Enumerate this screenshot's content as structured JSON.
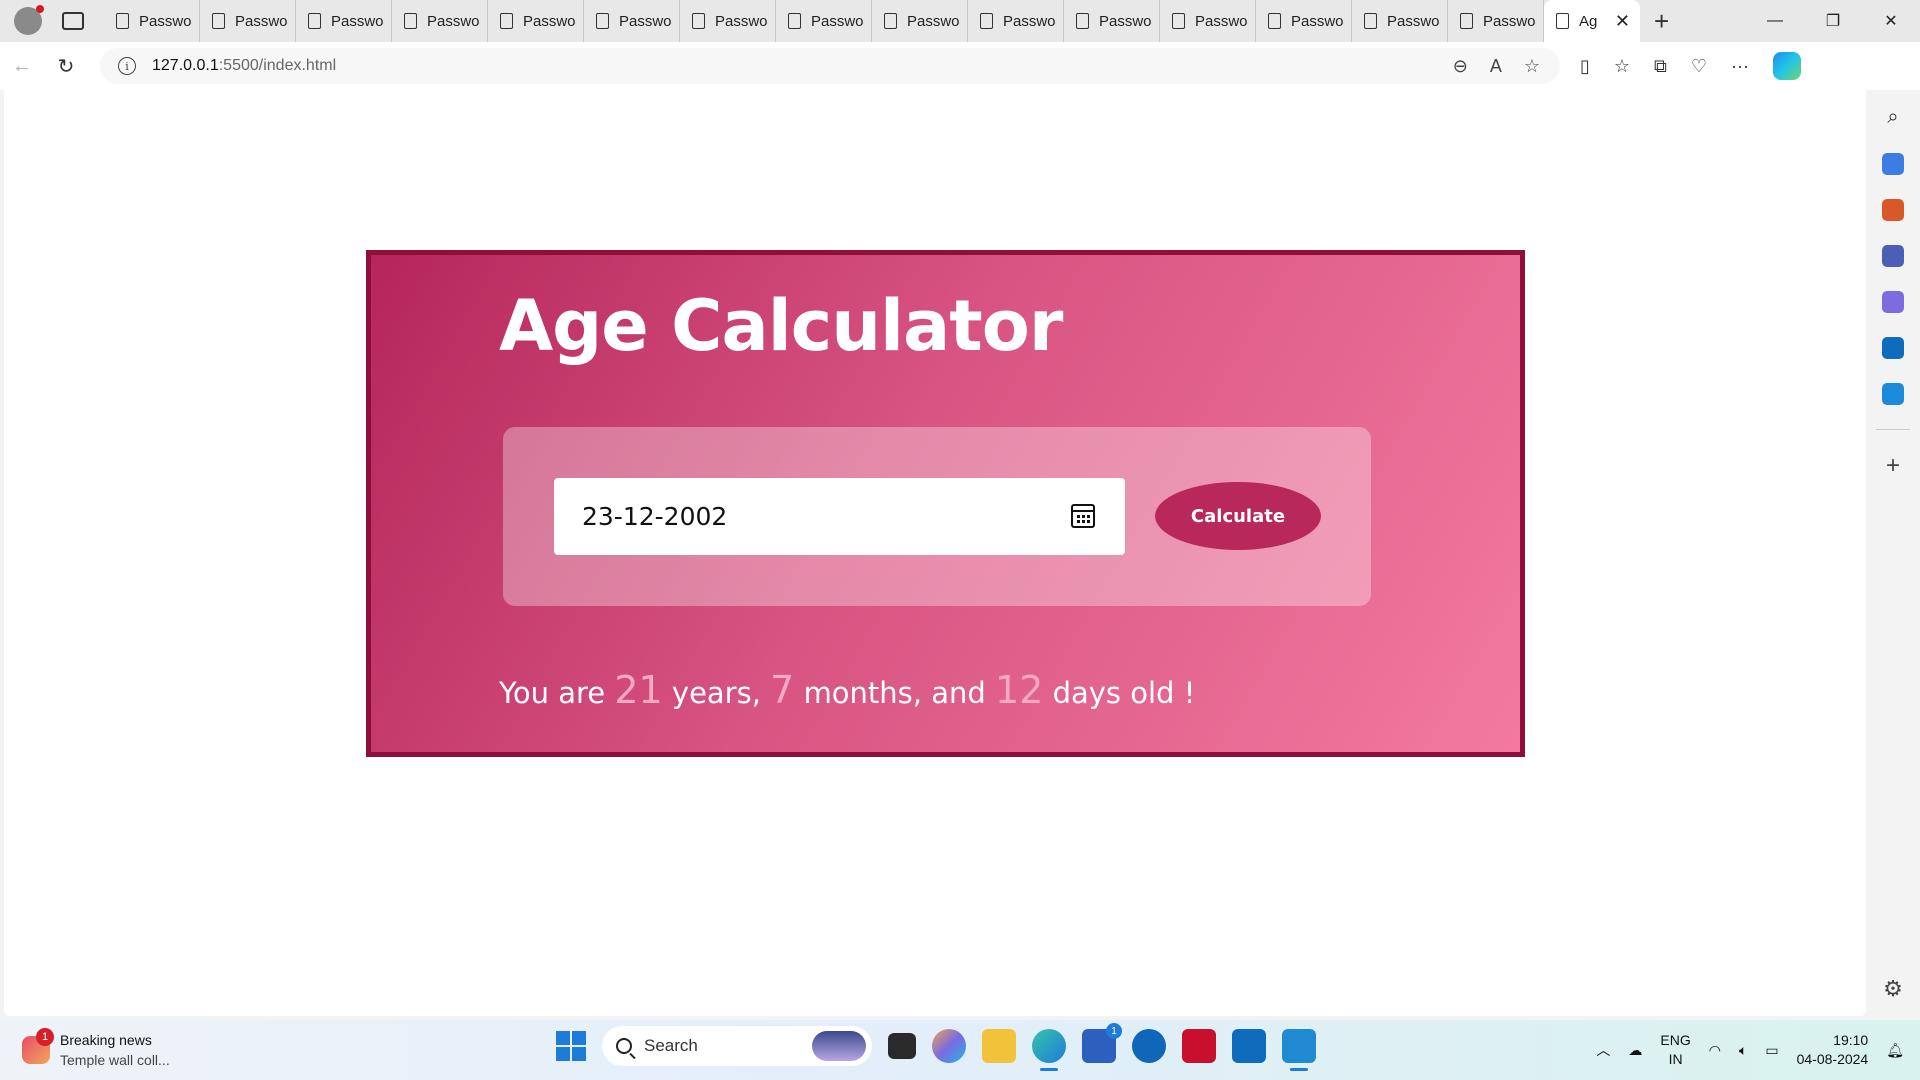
{
  "browser": {
    "tabs": [
      {
        "label": "Passwo"
      },
      {
        "label": "Passwo"
      },
      {
        "label": "Passwo"
      },
      {
        "label": "Passwo"
      },
      {
        "label": "Passwo"
      },
      {
        "label": "Passwo"
      },
      {
        "label": "Passwo"
      },
      {
        "label": "Passwo"
      },
      {
        "label": "Passwo"
      },
      {
        "label": "Passwo"
      },
      {
        "label": "Passwo"
      },
      {
        "label": "Passwo"
      },
      {
        "label": "Passwo"
      },
      {
        "label": "Passwo"
      },
      {
        "label": "Passwo"
      },
      {
        "label": "Ag",
        "active": true
      }
    ],
    "url_host": "127.0.0.1",
    "url_path": ":5500/index.html"
  },
  "page": {
    "title": "Age Calculator",
    "date_value": "23-12-2002",
    "button_label": "Calculate",
    "result": {
      "prefix": "You are",
      "years": "21",
      "years_label": "years,",
      "months": "7",
      "months_label": "months, and",
      "days": "12",
      "days_label": "days old !"
    }
  },
  "colors": {
    "card_border": "#8f0e3c",
    "gradient_start": "#b5265a",
    "gradient_end": "#f27aa0",
    "button": "#b8285a",
    "result_number": "#f6a9c3"
  },
  "taskbar": {
    "news_title": "Breaking news",
    "news_subtitle": "Temple wall coll...",
    "news_badge": "1",
    "search_placeholder": "Search",
    "store_badge": "1",
    "lang_top": "ENG",
    "lang_bottom": "IN",
    "time": "19:10",
    "date": "04-08-2024"
  }
}
